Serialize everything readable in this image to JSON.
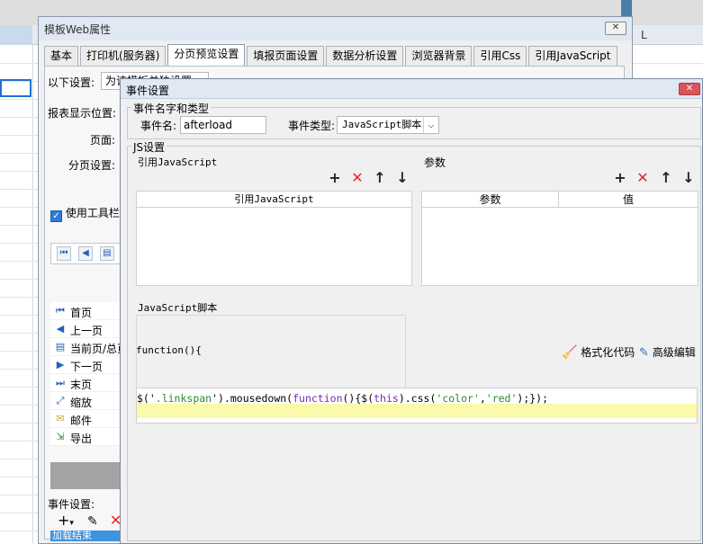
{
  "sheet": {
    "column_label": "L"
  },
  "back_window": {
    "title": "模板Web属性",
    "close_glyph": "✕",
    "tabs": [
      {
        "label": "基本"
      },
      {
        "label": "打印机(服务器)"
      },
      {
        "label": "分页预览设置",
        "active": true
      },
      {
        "label": "填报页面设置"
      },
      {
        "label": "数据分析设置"
      },
      {
        "label": "浏览器背景"
      },
      {
        "label": "引用Css"
      },
      {
        "label": "引用JavaScript"
      }
    ],
    "following_label": "以下设置:",
    "combo_value": "为该模板单独设置",
    "report_position_label": "报表显示位置:",
    "page_label": "页面:",
    "paging_label": "分页设置:",
    "use_toolbar_label": "使用工具栏",
    "buttons": [
      {
        "icon": "first-page-icon",
        "glyph": "⏮",
        "label": "首页"
      },
      {
        "icon": "prev-page-icon",
        "glyph": "◀",
        "label": "上一页"
      },
      {
        "icon": "current-page-icon",
        "glyph": "▤",
        "label": "当前页/总页"
      },
      {
        "icon": "next-page-icon",
        "glyph": "▶",
        "label": "下一页"
      },
      {
        "icon": "last-page-icon",
        "glyph": "⏭",
        "label": "末页"
      },
      {
        "icon": "zoom-icon",
        "glyph": "⤢",
        "label": "缩放"
      },
      {
        "icon": "mail-icon",
        "glyph": "✉",
        "label": "邮件"
      },
      {
        "icon": "export-icon",
        "glyph": "⇲",
        "label": "导出"
      }
    ],
    "event_settings_label": "事件设置:",
    "event_selected": "加载结束"
  },
  "dialog": {
    "title": "事件设置",
    "close_glyph": "✕",
    "name_type_group": "事件名字和类型",
    "event_name_label": "事件名:",
    "event_name_value": "afterload",
    "event_type_label": "事件类型:",
    "event_type_value": "JavaScript脚本",
    "js_group": "JS设置",
    "ref_js_label": "引用JavaScript",
    "params_label": "参数",
    "ref_js_col": "引用JavaScript",
    "param_col": "参数",
    "value_col": "值",
    "script_label": "JavaScript脚本",
    "function_header": "function(){",
    "format_label": "格式化代码",
    "advanced_label": "高级编辑",
    "code_tokens": [
      {
        "t": "$('",
        "c": "def"
      },
      {
        "t": ".linkspan",
        "c": "str"
      },
      {
        "t": "').mousedown(",
        "c": "def"
      },
      {
        "t": "function",
        "c": "kw"
      },
      {
        "t": "(){$(",
        "c": "def"
      },
      {
        "t": "this",
        "c": "kw"
      },
      {
        "t": ").css(",
        "c": "def"
      },
      {
        "t": "'color'",
        "c": "str"
      },
      {
        "t": ",",
        "c": "def"
      },
      {
        "t": "'red'",
        "c": "str"
      },
      {
        "t": ");});",
        "c": "def"
      }
    ]
  },
  "colors": {
    "accent_blue": "#2e7bd6",
    "delete_red": "#e02a2a",
    "code_highlight": "#fafaaa",
    "selection_blue": "#3f93dd"
  }
}
